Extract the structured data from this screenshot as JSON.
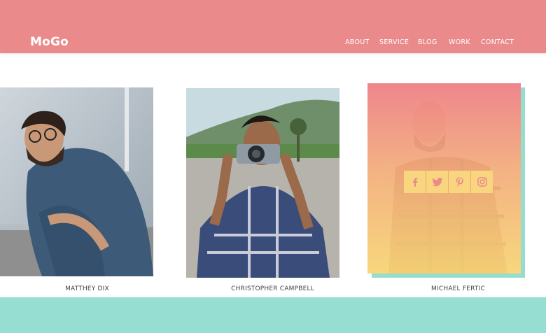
{
  "brand": {
    "logo": "MoGo"
  },
  "nav": {
    "items": [
      "ABOUT",
      "SERVICE",
      "BLOG",
      "WORK",
      "CONTACT"
    ]
  },
  "team": [
    {
      "name": "MATTHEY DIX"
    },
    {
      "name": "CHRISTOPHER CAMPBELL"
    },
    {
      "name": "MICHAEL FERTIC"
    }
  ],
  "social_icons": [
    "facebook-icon",
    "twitter-icon",
    "pinterest-icon",
    "instagram-icon"
  ],
  "colors": {
    "header": "#ea8a8b",
    "accent_teal": "#95ded1",
    "social_button": "#f8d57e",
    "icon": "#ea8a8b",
    "gradient_top": "#f18089",
    "gradient_bottom": "#fad878"
  }
}
